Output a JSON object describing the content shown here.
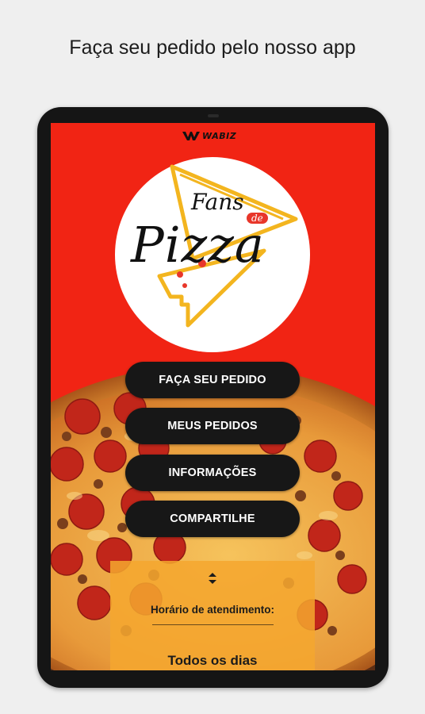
{
  "headline": "Faça seu pedido pelo nosso app",
  "brand": {
    "name": "WABIZ"
  },
  "logo": {
    "line1": "Fans",
    "connector": "de",
    "line2": "Pizza"
  },
  "menu": [
    {
      "label": "FAÇA SEU PEDIDO"
    },
    {
      "label": "MEUS PEDIDOS"
    },
    {
      "label": "INFORMAÇÕES"
    },
    {
      "label": "COMPARTILHE"
    }
  ],
  "info": {
    "hours_label": "Horário de atendimento:",
    "days": "Todos os dias"
  },
  "colors": {
    "background": "#efefef",
    "screen_red": "#f12414",
    "button_dark": "#171717",
    "logo_yellow": "#f3b51f",
    "panel_orange": "#f4a62e"
  },
  "icons": [
    "wabiz-logo-icon",
    "scroll-chevrons-icon",
    "pizza-slice-icon"
  ]
}
